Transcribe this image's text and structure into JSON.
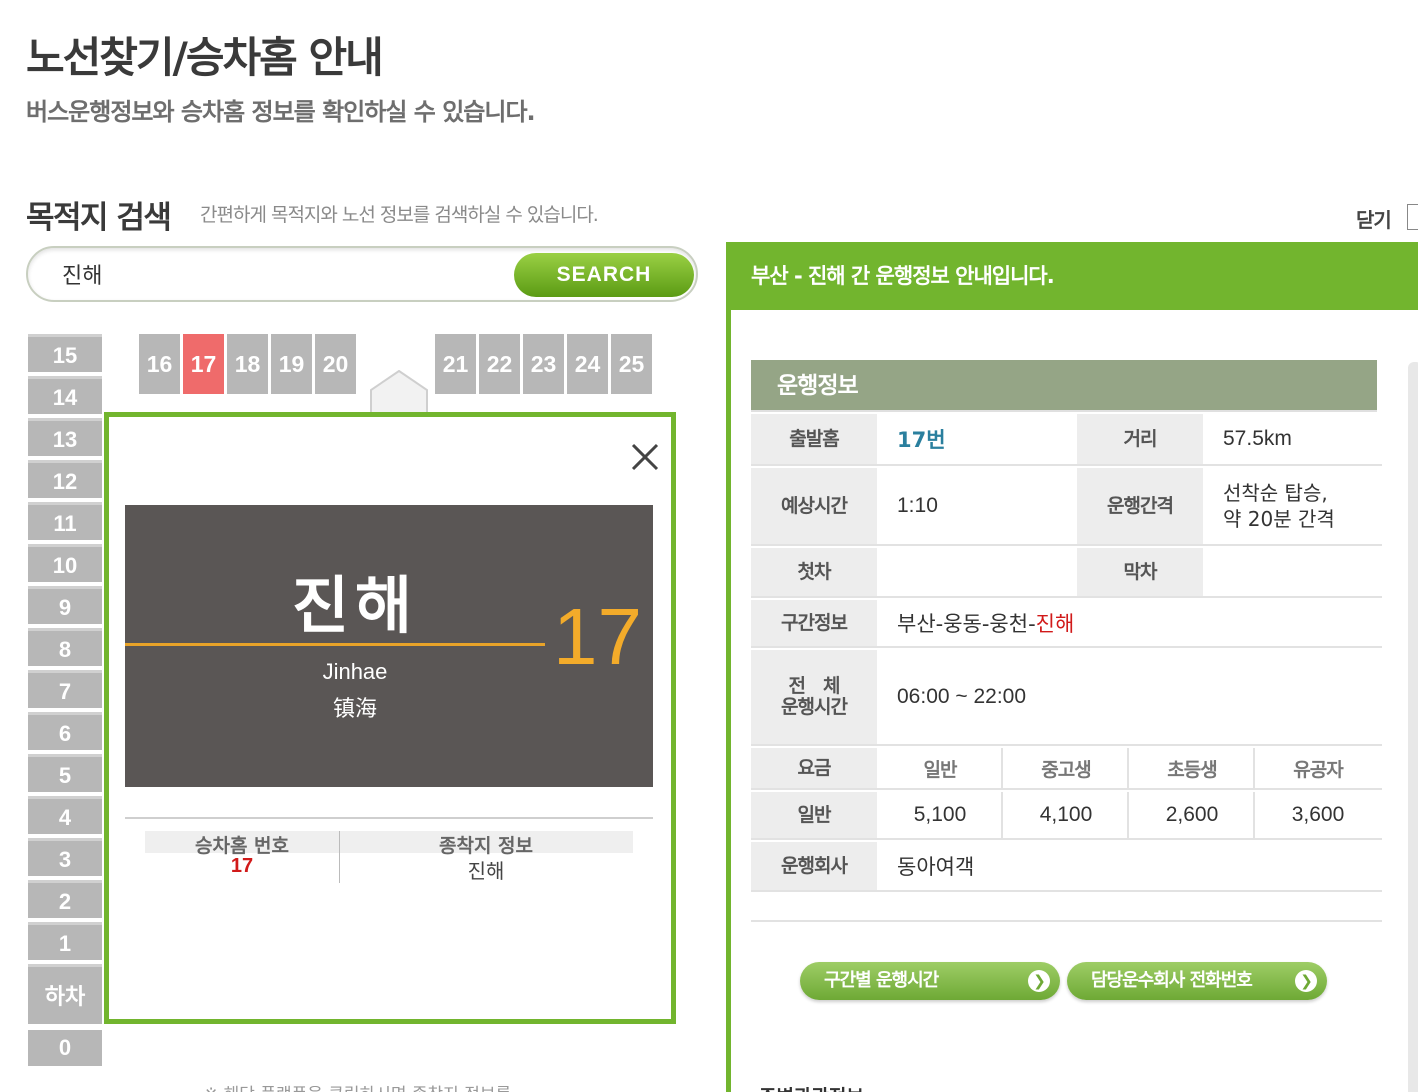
{
  "header": {
    "title": "노선찾기/승차홈 안내",
    "subtitle": "버스운행정보와 승차홈 정보를 확인하실 수 있습니다."
  },
  "search_section": {
    "title": "목적지 검색",
    "description": "간편하게 목적지와 노선 정보를 검색하실 수 있습니다.",
    "close_label": "닫기",
    "input_value": "진해",
    "button_label": "SEARCH"
  },
  "platforms": {
    "vertical": [
      "15",
      "14",
      "13",
      "12",
      "11",
      "10",
      "9",
      "8",
      "7",
      "6",
      "5",
      "4",
      "3",
      "2",
      "1",
      "하차",
      "0"
    ],
    "horizontal_left": [
      "16",
      "17",
      "18",
      "19",
      "20"
    ],
    "horizontal_right": [
      "21",
      "22",
      "23",
      "24",
      "25"
    ],
    "active": "17"
  },
  "popup": {
    "sign_korean": "진해",
    "sign_number": "17",
    "sign_english": "Jinhae",
    "sign_chinese": "镇海",
    "info_header_1": "승차홈 번호",
    "info_header_2": "종착지 정보",
    "info_value_1": "17",
    "info_value_2": "진해"
  },
  "bottom_note": "※ 해당 플랫폼을 클릭하시면 종착지 정보를",
  "route_panel": {
    "header": "부산 - 진해 간 운행정보 안내입니다.",
    "section_title": "운행정보",
    "labels": {
      "departure": "출발홈",
      "distance": "거리",
      "duration": "예상시간",
      "interval": "운행간격",
      "first": "첫차",
      "last": "막차",
      "section": "구간정보",
      "hours_1": "전　체",
      "hours_2": "운행시간",
      "fare": "요금",
      "fare_row": "일반",
      "company": "운행회사"
    },
    "values": {
      "departure": "17번",
      "distance": "57.5km",
      "duration": "1:10",
      "interval_1": "선착순 탑승,",
      "interval_2": "약 20분 간격",
      "first": "",
      "last": "",
      "section_prefix": "부산-웅동-웅천-",
      "section_dest": "진해",
      "hours": "06:00 ~ 22:00",
      "company": "동아여객"
    },
    "fare_headers": [
      "일반",
      "중고생",
      "초등생",
      "유공자"
    ],
    "fare_values": [
      "5,100",
      "4,100",
      "2,600",
      "3,600"
    ],
    "button_1": "구간별 운행시간",
    "button_2": "담당운수회사 전화번호",
    "bottom_title": "주변관광정보"
  },
  "colors": {
    "accent_green": "#72b52e",
    "active_tile": "#ef6b6b",
    "sign_board": "#5a5655",
    "sign_number": "#f3ab2a",
    "highlight_red": "#d11a1a",
    "platform_link": "#2a7f9e"
  }
}
